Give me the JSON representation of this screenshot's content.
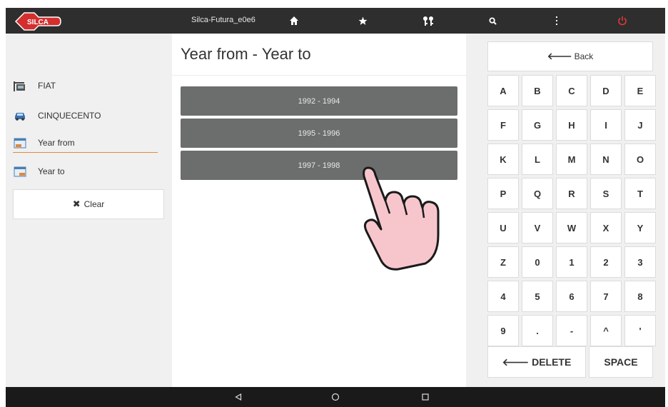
{
  "topbar": {
    "device_name": "Silca-Futura_e0e6",
    "icons": [
      "silca-logo",
      "home-icon",
      "star-icon",
      "key-pair-icon",
      "search-icon",
      "more-vertical-icon",
      "power-icon"
    ],
    "power_color": "#e53935",
    "logo_color": "#d32f2f"
  },
  "sidebar": {
    "items": [
      {
        "label": "FIAT",
        "icon": "car-brand-icon"
      },
      {
        "label": "CINQUECENTO",
        "icon": "car-model-icon"
      },
      {
        "label": "Year from",
        "icon": "calendar-from-icon",
        "active": true
      },
      {
        "label": "Year to",
        "icon": "calendar-to-icon"
      }
    ],
    "clear_icon": "✖",
    "clear_label": "Clear",
    "active_underline_color": "#e08a3a"
  },
  "main": {
    "title": "Year from - Year to",
    "options": [
      "1992 - 1994",
      "1995 - 1996",
      "1997 - 1998"
    ]
  },
  "keyboard": {
    "back_icon": "🡐",
    "back_label": "Back",
    "rows": [
      [
        "A",
        "B",
        "C",
        "D",
        "E"
      ],
      [
        "F",
        "G",
        "H",
        "I",
        "J"
      ],
      [
        "K",
        "L",
        "M",
        "N",
        "O"
      ],
      [
        "P",
        "Q",
        "R",
        "S",
        "T"
      ],
      [
        "U",
        "V",
        "W",
        "X",
        "Y"
      ],
      [
        "Z",
        "0",
        "1",
        "2",
        "3"
      ],
      [
        "4",
        "5",
        "6",
        "7",
        "8"
      ],
      [
        "9",
        ".",
        "-",
        "^",
        "'"
      ]
    ],
    "delete_label": "🡐 DELETE",
    "space_label": "SPACE"
  },
  "android_nav": [
    "back-triangle-icon",
    "home-circle-icon",
    "recents-square-icon"
  ],
  "overlay": {
    "icon": "pointing-hand-icon",
    "color": "#f7c6cd"
  }
}
